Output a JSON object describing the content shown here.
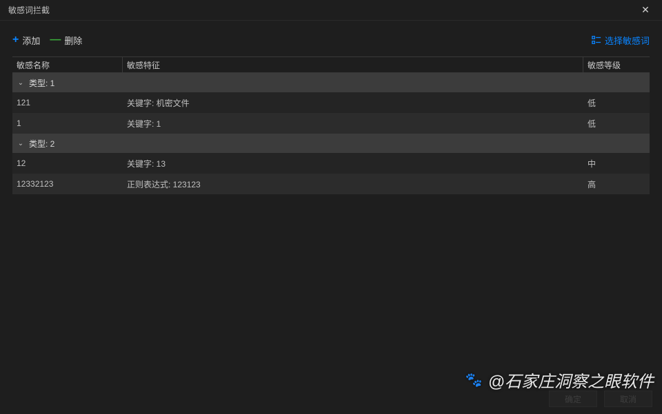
{
  "window": {
    "title": "敏感词拦截"
  },
  "toolbar": {
    "add_label": "添加",
    "delete_label": "删除",
    "select_label": "选择敏感词"
  },
  "columns": {
    "name": "敏感名称",
    "feature": "敏感特征",
    "level": "敏感等级"
  },
  "groups": [
    {
      "label": "类型: 1",
      "rows": [
        {
          "name": "121",
          "feature": "关键字: 机密文件",
          "level": "低"
        },
        {
          "name": "1",
          "feature": "关键字: 1",
          "level": "低"
        }
      ]
    },
    {
      "label": "类型: 2",
      "rows": [
        {
          "name": "12",
          "feature": "关键字: 13",
          "level": "中"
        },
        {
          "name": "12332123",
          "feature": "正则表达式: 123123",
          "level": "高"
        }
      ]
    }
  ],
  "footer": {
    "ok": "确定",
    "cancel": "取消"
  },
  "watermark": "@石家庄洞察之眼软件"
}
